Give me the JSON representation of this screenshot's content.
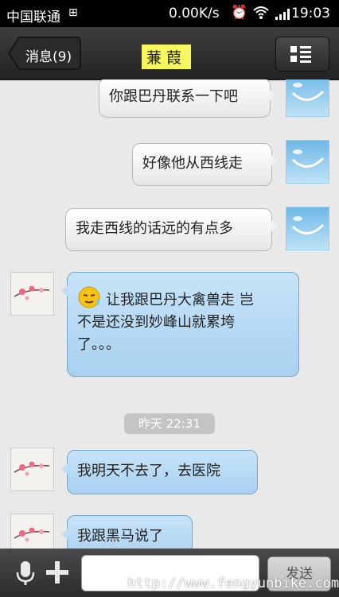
{
  "status_bar": {
    "carrier": "中国联通",
    "speed": "0.00K/s",
    "time": "19:03"
  },
  "header": {
    "back_label": "消息(9)",
    "contact_name": "蒹葭"
  },
  "messages": [
    {
      "side": "sent",
      "text": "你跟巴丹联系一下吧"
    },
    {
      "side": "sent",
      "text": "好像他从西线走"
    },
    {
      "side": "sent",
      "text": "我走西线的话远的有点多"
    },
    {
      "side": "received",
      "line1": "让我跟巴丹大禽兽走 岂",
      "line2": "不是还没到妙峰山就累垮",
      "line3": "了。。。"
    },
    {
      "side": "received",
      "text": "我明天不去了，去医院"
    },
    {
      "side": "received",
      "text": "我跟黑马说了"
    }
  ],
  "timestamp": "昨天 22:31",
  "input_bar": {
    "send_label": "发送",
    "text_value": ""
  },
  "watermark": "http://www.fengyunbike.com"
}
